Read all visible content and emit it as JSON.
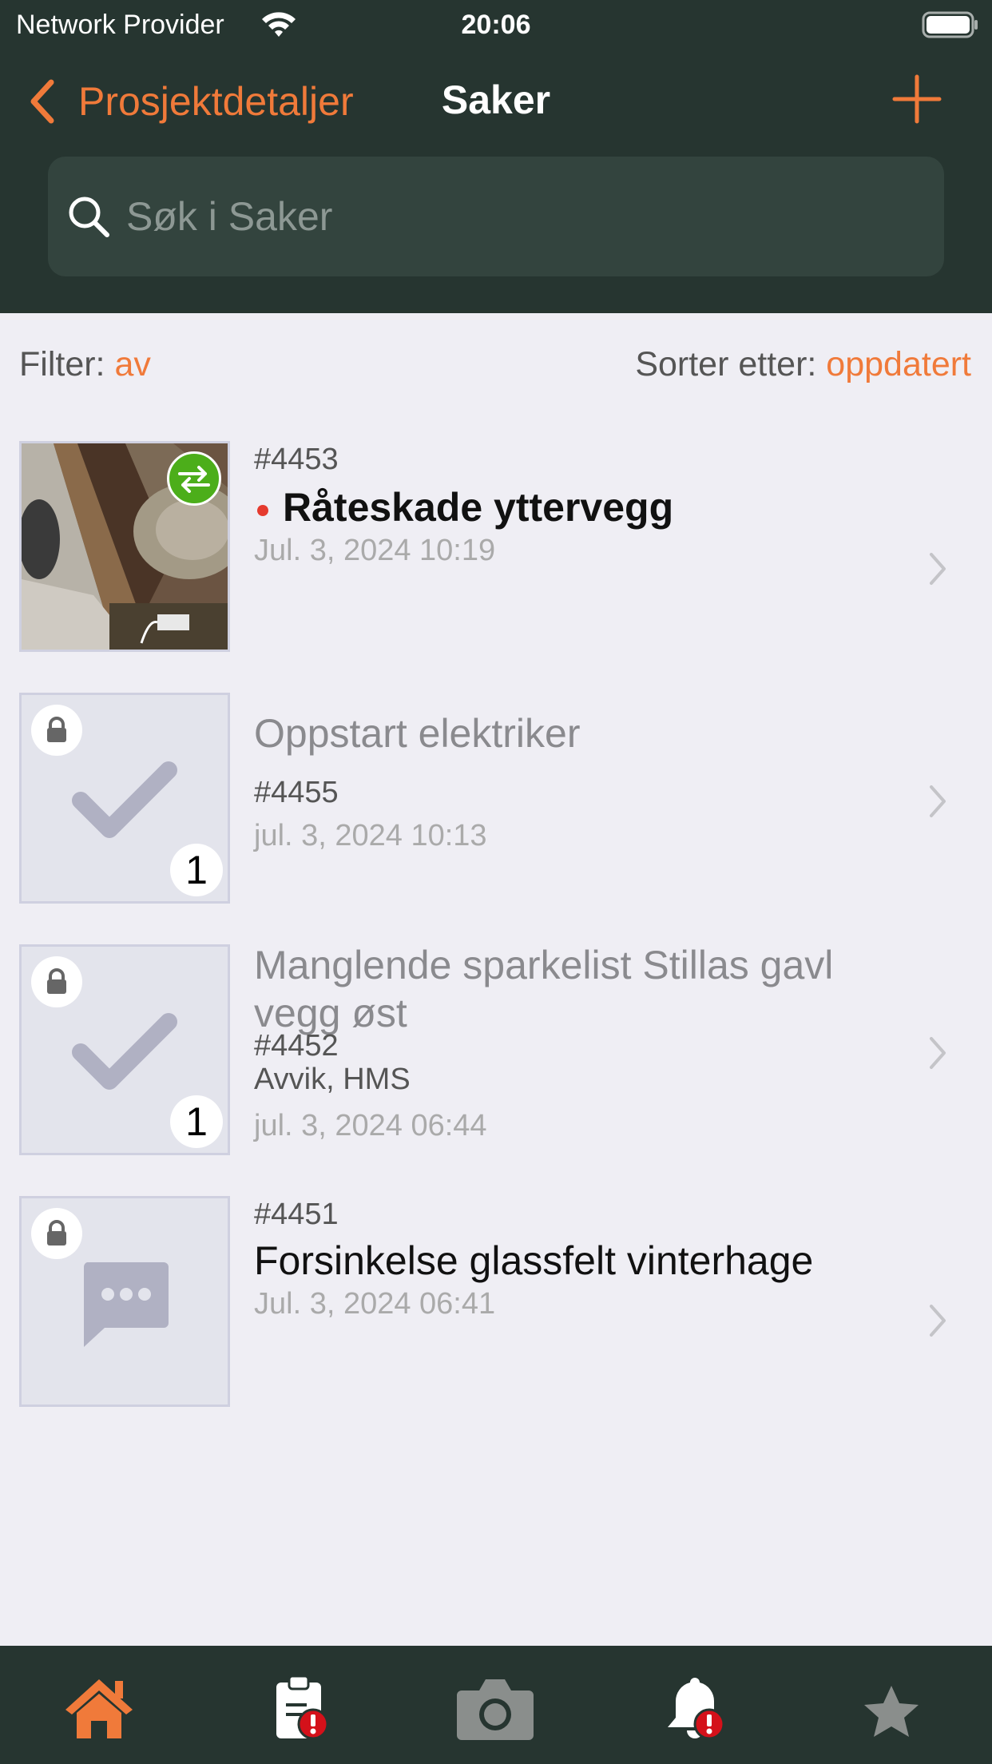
{
  "status_bar": {
    "carrier": "Network Provider",
    "time": "20:06"
  },
  "nav": {
    "back_label": "Prosjektdetaljer",
    "title": "Saker"
  },
  "search": {
    "placeholder": "Søk i Saker"
  },
  "filter": {
    "label": "Filter:",
    "value": "av"
  },
  "sort": {
    "label": "Sorter etter:",
    "value": "oppdatert"
  },
  "cases": [
    {
      "id": "#4453",
      "title": "Råteskade yttervegg",
      "date": "Jul. 3, 2024 10:19",
      "unread": true
    },
    {
      "id": "#4455",
      "title": "Oppstart elektriker",
      "date": "jul. 3, 2024 10:13",
      "count": "1",
      "icon": "checkmark-icon",
      "locked": true
    },
    {
      "id": "#4452",
      "title_line1": "Manglende sparkelist Stillas gavl",
      "title_line2": "vegg øst",
      "categories": "Avvik, HMS",
      "date": "jul. 3, 2024 06:44",
      "count": "1",
      "icon": "checkmark-icon",
      "locked": true
    },
    {
      "id": "#4451",
      "title": "Forsinkelse glassfelt vinterhage",
      "date": "Jul. 3, 2024 06:41",
      "icon": "chat-bubble-icon",
      "locked": true
    }
  ],
  "tabs": [
    "home-icon",
    "clipboard-alert-icon",
    "camera-icon",
    "bell-alert-icon",
    "star-icon"
  ],
  "colors": {
    "accent": "#f07a3a",
    "header_bg": "#263530",
    "list_bg": "#efeef4",
    "unread_dot": "#e53a2e",
    "sync_badge": "#4cae1a"
  }
}
